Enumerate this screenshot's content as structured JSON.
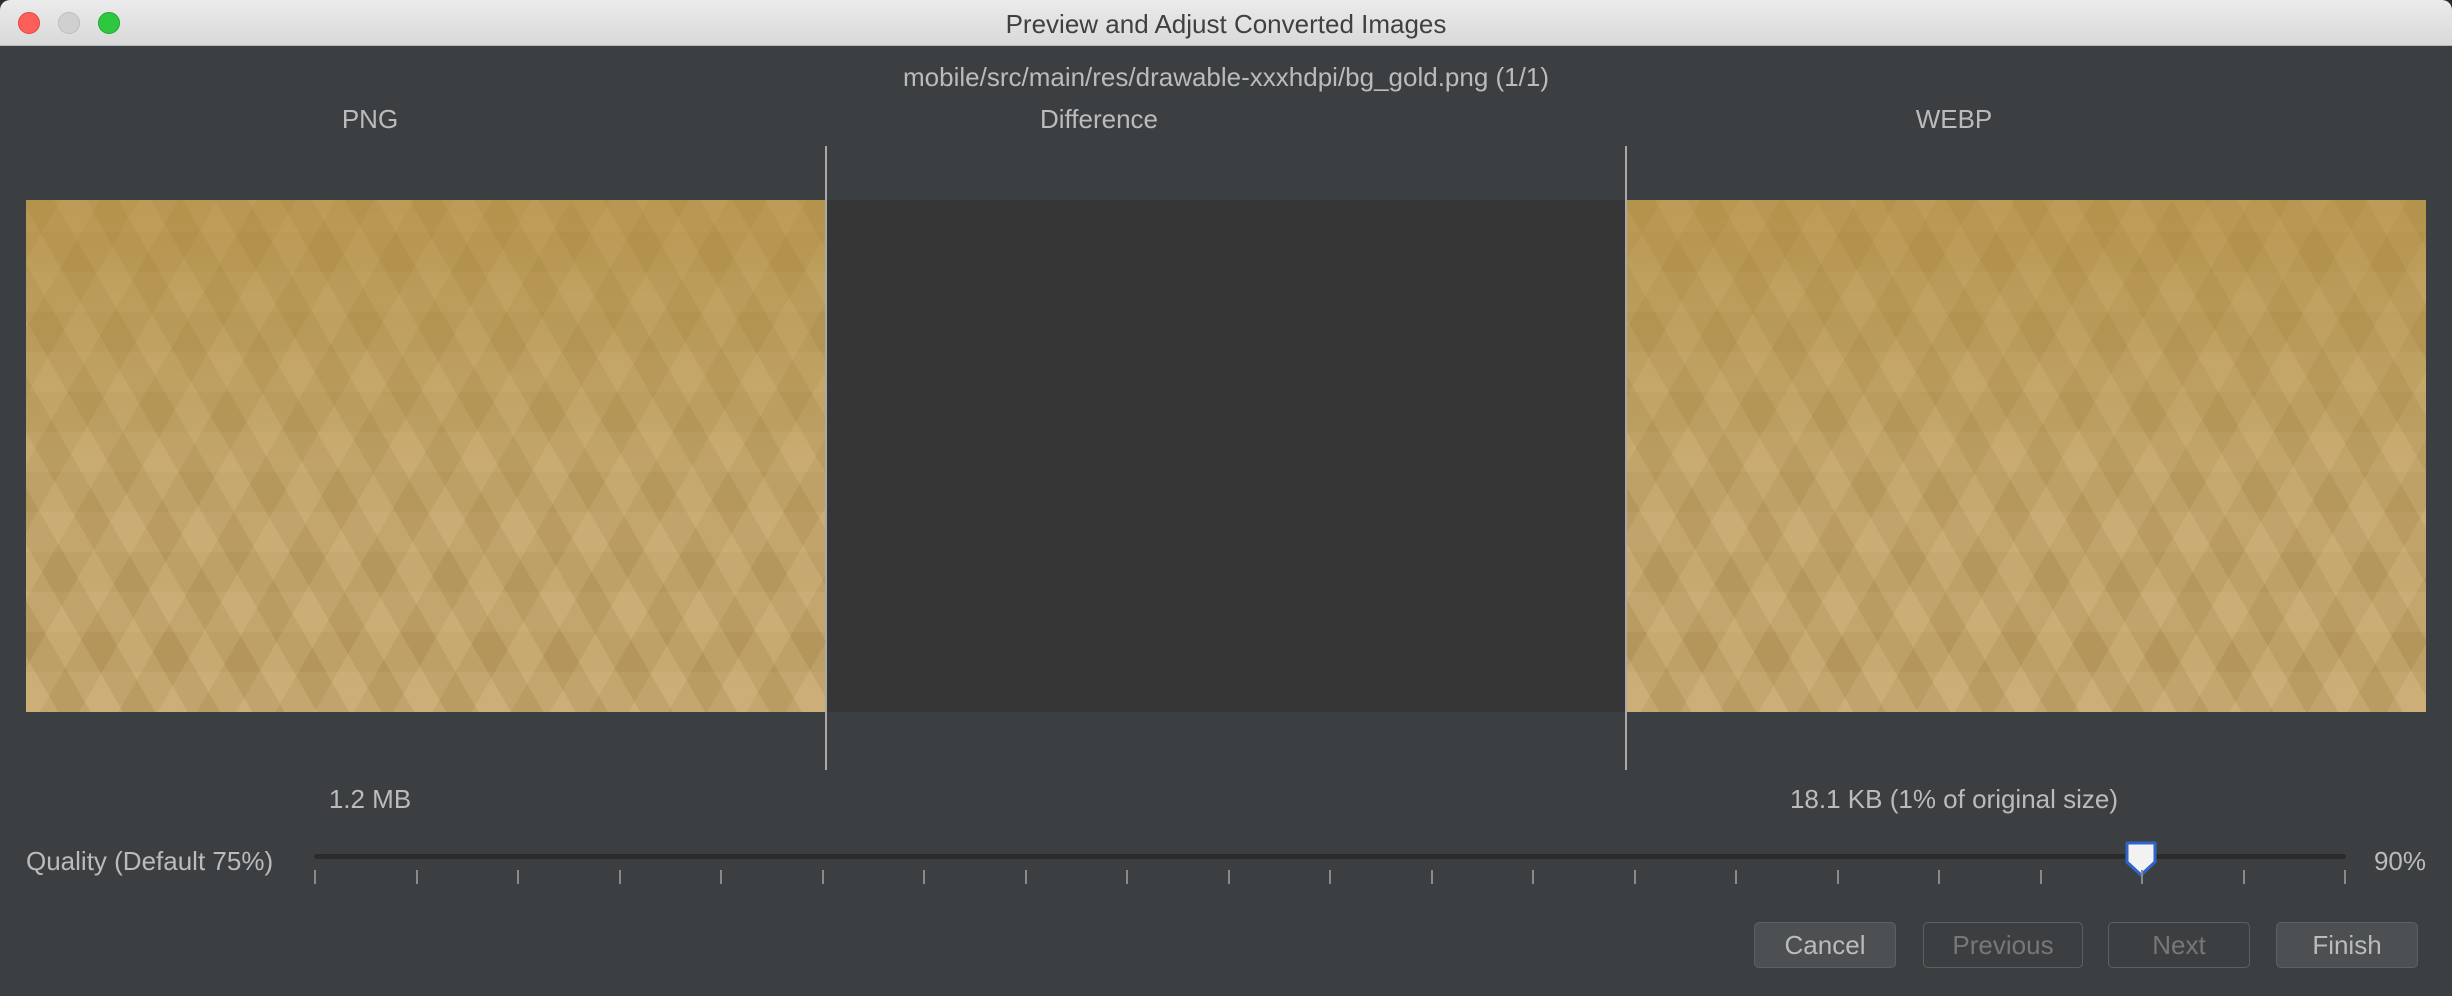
{
  "window": {
    "title": "Preview and Adjust Converted Images"
  },
  "file": {
    "path": "mobile/src/main/res/drawable-xxxhdpi/bg_gold.png (1/1)"
  },
  "columns": {
    "png_header": "PNG",
    "difference_header": "Difference",
    "webp_header": "WEBP"
  },
  "sizes": {
    "png_size": "1.2 MB",
    "webp_size": "18.1 KB (1% of original size)"
  },
  "quality": {
    "label": "Quality (Default 75%)",
    "value_text": "90%",
    "value": 90,
    "min": 0,
    "max": 100,
    "tick_step": 5
  },
  "buttons": {
    "cancel": "Cancel",
    "previous": "Previous",
    "next": "Next",
    "finish": "Finish"
  },
  "colors": {
    "window_bg": "#3c3f41",
    "gold": "#c4a464",
    "difference_bg": "#363636"
  }
}
